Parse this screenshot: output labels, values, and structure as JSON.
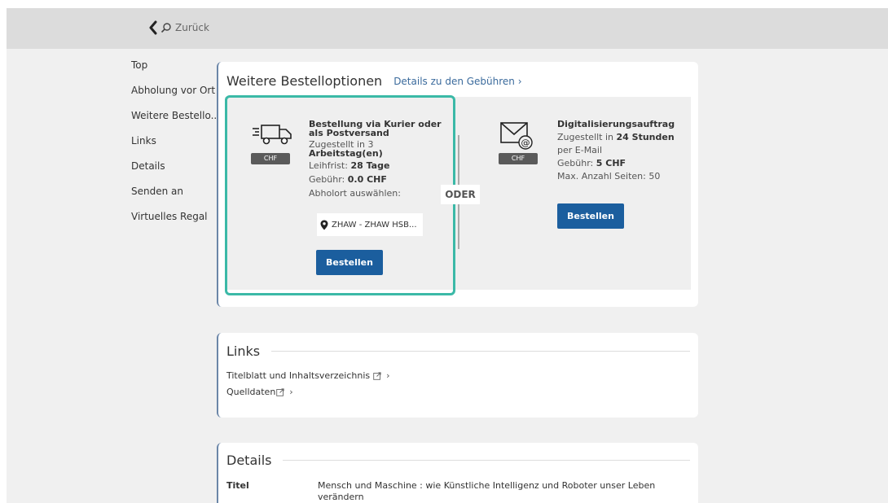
{
  "header": {
    "back_label": "Zurück"
  },
  "sidebar": {
    "items": [
      {
        "label": "Top"
      },
      {
        "label": "Abholung vor Ort"
      },
      {
        "label": "Weitere Bestello..."
      },
      {
        "label": "Links"
      },
      {
        "label": "Details"
      },
      {
        "label": "Senden an"
      },
      {
        "label": "Virtuelles Regal"
      }
    ]
  },
  "order_options": {
    "title": "Weitere Bestelloptionen",
    "fee_link": "Details zu den Gebühren",
    "separator": "ODER",
    "courier": {
      "title_line1": "Bestellung via Kurier oder",
      "title_line2": "als Postversand",
      "delivery_prefix": "Zugestellt in 3",
      "delivery_unit": "Arbeitstag(en)",
      "loan_label": "Leihfrist:",
      "loan_value": "28 Tage",
      "fee_label": "Gebühr:",
      "fee_value": "0.0  CHF",
      "pickup_label": "Abholort auswählen:",
      "pickup_value": "ZHAW - ZHAW HSB...",
      "badge": "CHF",
      "button": "Bestellen"
    },
    "digital": {
      "title": "Digitalisierungsauftrag",
      "delivery_prefix": "Zugestellt in",
      "delivery_value": "24 Stunden",
      "method": "per E-Mail",
      "fee_label": "Gebühr:",
      "fee_value": "5  CHF",
      "max_pages": "Max. Anzahl Seiten: 50",
      "badge": "CHF",
      "button": "Bestellen"
    }
  },
  "links": {
    "title": "Links",
    "items": [
      {
        "label": "Titelblatt und Inhaltsverzeichnis"
      },
      {
        "label": "Quelldaten"
      }
    ]
  },
  "details": {
    "title": "Details",
    "rows": [
      {
        "key": "Titel",
        "value": "Mensch und Maschine : wie Künstliche Intelligenz und Roboter unser Leben verändern"
      }
    ]
  },
  "colors": {
    "accent_button": "#1b5e9e",
    "highlight_border": "#3bb9a7",
    "link": "#3a6a9c"
  }
}
